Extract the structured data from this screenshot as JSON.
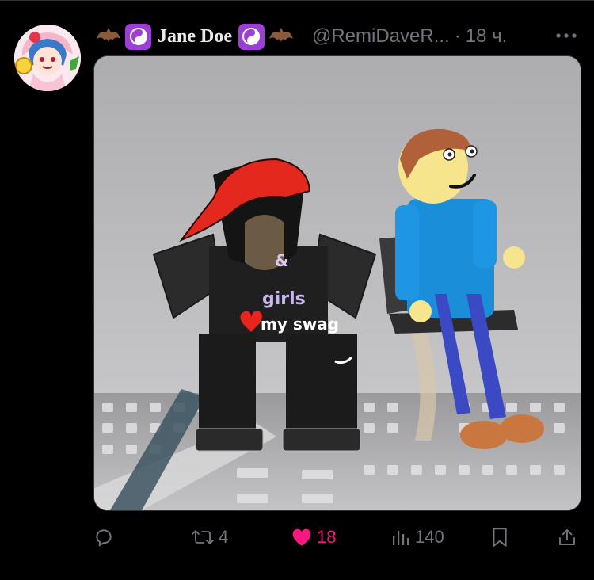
{
  "tweet": {
    "author_name": "Jane Doe",
    "handle": "@RemiDaveR...",
    "separator": "·",
    "time": "18 ч.",
    "name_emojis": [
      "bat-emoji",
      "yin-yang-emoji",
      "yin-yang-emoji",
      "bat-emoji"
    ]
  },
  "media": {
    "shirt_text": [
      "&",
      "girls",
      "my swag"
    ],
    "shoe_logo": "nike-swoosh"
  },
  "actions": {
    "reply": {
      "icon": "reply-icon",
      "count": ""
    },
    "retweet": {
      "icon": "retweet-icon",
      "count": "4"
    },
    "like": {
      "icon": "heart-icon",
      "count": "18",
      "active": true,
      "color": "#f91880"
    },
    "views": {
      "icon": "views-icon",
      "count": "140"
    },
    "bookmark": {
      "icon": "bookmark-icon",
      "count": ""
    },
    "share": {
      "icon": "share-icon",
      "count": ""
    }
  },
  "colors": {
    "background": "#000000",
    "text": "#e7e9ea",
    "muted": "#71767b",
    "like": "#f91880",
    "emoji_purple": "#9b3fd6"
  }
}
